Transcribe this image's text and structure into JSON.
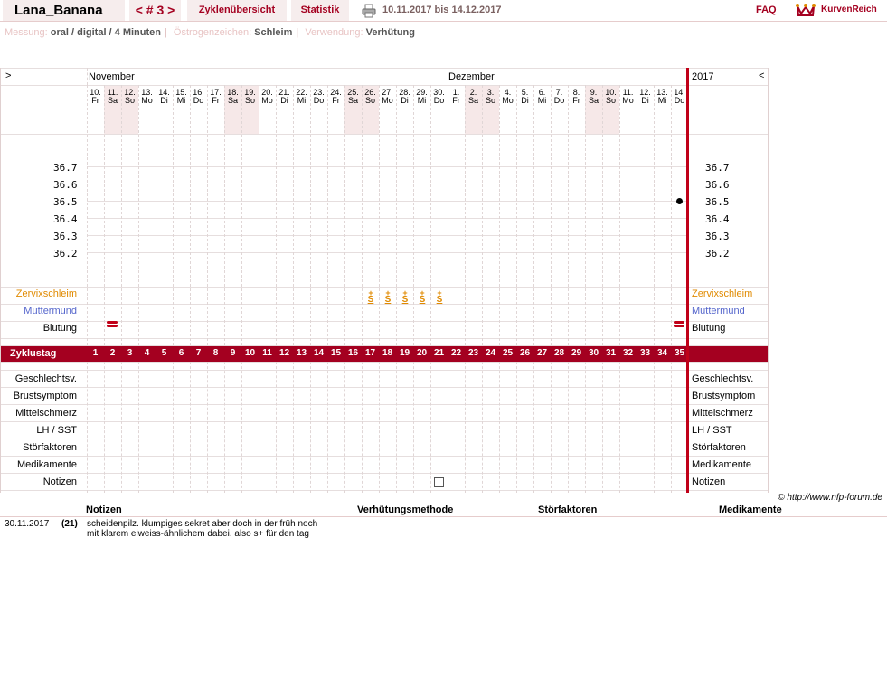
{
  "header": {
    "username": "Lana_Banana",
    "cycle_nav": "< # 3 >",
    "overview": "Zyklenübersicht",
    "stats": "Statistik",
    "daterange": "10.11.2017 bis 14.12.2017",
    "faq": "FAQ",
    "logo": "KurvenReich"
  },
  "info": {
    "measure_label": "Messung:",
    "measure": "oral / digital / 4 Minuten",
    "estrogen_label": "Östrogenzeichen:",
    "estrogen": "Schleim",
    "use_label": "Verwendung:",
    "use": "Verhütung"
  },
  "chart": {
    "left_arrow": ">",
    "right_arrow": "<",
    "month1": "November",
    "month2": "Dezember",
    "year": "2017",
    "days": [
      [
        "10.",
        "Fr"
      ],
      [
        "11.",
        "Sa"
      ],
      [
        "12.",
        "So"
      ],
      [
        "13.",
        "Mo"
      ],
      [
        "14.",
        "Di"
      ],
      [
        "15.",
        "Mi"
      ],
      [
        "16.",
        "Do"
      ],
      [
        "17.",
        "Fr"
      ],
      [
        "18.",
        "Sa"
      ],
      [
        "19.",
        "So"
      ],
      [
        "20.",
        "Mo"
      ],
      [
        "21.",
        "Di"
      ],
      [
        "22.",
        "Mi"
      ],
      [
        "23.",
        "Do"
      ],
      [
        "24.",
        "Fr"
      ],
      [
        "25.",
        "Sa"
      ],
      [
        "26.",
        "So"
      ],
      [
        "27.",
        "Mo"
      ],
      [
        "28.",
        "Di"
      ],
      [
        "29.",
        "Mi"
      ],
      [
        "30.",
        "Do"
      ],
      [
        "1.",
        "Fr"
      ],
      [
        "2.",
        "Sa"
      ],
      [
        "3.",
        "So"
      ],
      [
        "4.",
        "Mo"
      ],
      [
        "5.",
        "Di"
      ],
      [
        "6.",
        "Mi"
      ],
      [
        "7.",
        "Do"
      ],
      [
        "8.",
        "Fr"
      ],
      [
        "9.",
        "Sa"
      ],
      [
        "10.",
        "So"
      ],
      [
        "11.",
        "Mo"
      ],
      [
        "12.",
        "Di"
      ],
      [
        "13.",
        "Mi"
      ],
      [
        "14.",
        "Do"
      ]
    ],
    "temps": [
      "36.7",
      "36.6",
      "36.5",
      "36.4",
      "36.3",
      "36.2"
    ],
    "temp_point": {
      "cycle_day": 35,
      "value": 36.5
    },
    "rows": {
      "cervix": "Zervixschleim",
      "mouth": "Muttermund",
      "bleeding": "Blutung",
      "cycleday": "Zyklustag",
      "sex": "Geschlechtsv.",
      "breast": "Brustsymptom",
      "midpain": "Mittelschmerz",
      "lh": "LH / SST",
      "disturb": "Störfaktoren",
      "meds": "Medikamente",
      "notes": "Notizen"
    },
    "mucus_days": [
      17,
      18,
      19,
      20,
      21
    ],
    "mucus_symbol": "S+",
    "bleeding_days": [
      2,
      35
    ],
    "note_day": 21,
    "cycle_days": [
      "1",
      "2",
      "3",
      "4",
      "5",
      "6",
      "7",
      "8",
      "9",
      "10",
      "11",
      "12",
      "13",
      "14",
      "15",
      "16",
      "17",
      "18",
      "19",
      "20",
      "21",
      "22",
      "23",
      "24",
      "25",
      "26",
      "27",
      "28",
      "29",
      "30",
      "31",
      "32",
      "33",
      "34",
      "35"
    ]
  },
  "copyright": "© http://www.nfp-forum.de",
  "notes": {
    "h_notes": "Notizen",
    "h_method": "Verhütungsmethode",
    "h_disturb": "Störfaktoren",
    "h_meds": "Medikamente",
    "entries": [
      {
        "date": "30.11.2017",
        "day": "(21)",
        "text": "scheidenpilz. klumpiges sekret aber doch in der früh noch mit klarem eiweiss-ähnlichem dabei. also s+ für den tag"
      }
    ]
  },
  "colors": {
    "accent": "#a40020",
    "bar": "#a40020",
    "cervix": "#e08a00",
    "mouth": "#5566cc",
    "weekend": "#f6e8e8"
  }
}
